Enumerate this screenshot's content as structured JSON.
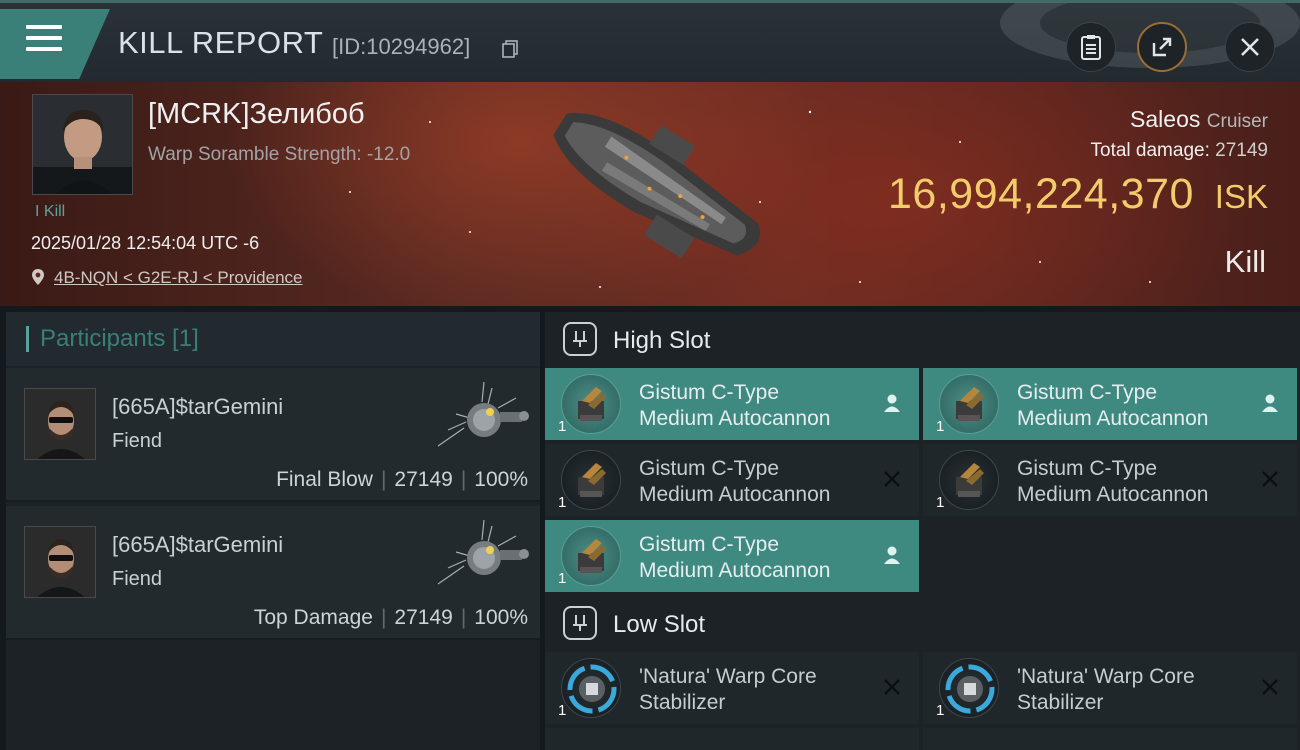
{
  "header": {
    "title": "KILL REPORT",
    "report_id": "[ID:10294962]"
  },
  "victim": {
    "name": "[MCRK]Зелибоб",
    "scramble": "Warp Soramble Strength: -12.0",
    "kill_tag": "I Kill",
    "datetime": "2025/01/28 12:54:04 UTC -6",
    "location": "4B-NQN < G2E-RJ < Providence",
    "ship_name": "Saleos",
    "ship_class": "Cruiser",
    "total_damage_label": "Total damage:",
    "total_damage": "27149",
    "isk_value": "16,994,224,370",
    "isk_unit": "ISK",
    "result": "Kill"
  },
  "participants": {
    "header": "Participants [1]",
    "rows": [
      {
        "name": "[665A]$tarGemini",
        "ship": "Fiend",
        "role": "Final Blow",
        "damage": "27149",
        "percent": "100%"
      },
      {
        "name": "[665A]$tarGemini",
        "ship": "Fiend",
        "role": "Top Damage",
        "damage": "27149",
        "percent": "100%"
      }
    ]
  },
  "fittings": {
    "high_slot": {
      "title": "High Slot",
      "modules": [
        {
          "line1": "Gistum C-Type",
          "line2": "Medium Autocannon",
          "qty": "1",
          "state": "person-icon"
        },
        {
          "line1": "Gistum C-Type",
          "line2": "Medium Autocannon",
          "qty": "1",
          "state": "person-icon"
        },
        {
          "line1": "Gistum C-Type",
          "line2": "Medium Autocannon",
          "qty": "1",
          "state": "destroyed-icon"
        },
        {
          "line1": "Gistum C-Type",
          "line2": "Medium Autocannon",
          "qty": "1",
          "state": "destroyed-icon"
        },
        {
          "line1": "Gistum C-Type",
          "line2": "Medium Autocannon",
          "qty": "1",
          "state": "person-icon"
        }
      ]
    },
    "low_slot": {
      "title": "Low Slot",
      "modules": [
        {
          "line1": "'Natura' Warp Core",
          "line2": "Stabilizer",
          "qty": "1",
          "state": "destroyed-icon"
        },
        {
          "line1": "'Natura' Warp Core",
          "line2": "Stabilizer",
          "qty": "1",
          "state": "destroyed-icon"
        }
      ]
    }
  },
  "colors": {
    "accent": "#3f8a80",
    "isk_gold": "#f2cc6a"
  }
}
